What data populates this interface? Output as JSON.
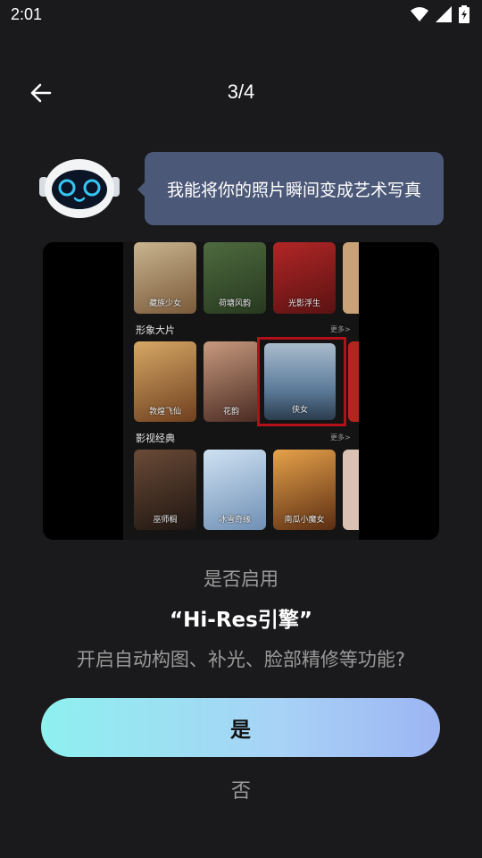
{
  "status": {
    "time": "2:01"
  },
  "header": {
    "page_indicator": "3/4"
  },
  "bubble": {
    "text": "我能将你的照片瞬间变成艺术写真"
  },
  "preview": {
    "row1_labels": [
      "藏族少女",
      "荷塘风韵",
      "光影浮生"
    ],
    "section2": {
      "title": "形象大片",
      "more": "更多>"
    },
    "row2_labels": [
      "敦煌飞仙",
      "花韵",
      "侠女"
    ],
    "section3": {
      "title": "影视经典",
      "more": "更多>"
    },
    "row3_labels": [
      "巫师榈",
      "冰雪奇缘",
      "南瓜小魔女"
    ]
  },
  "prompt": {
    "line1": "是否启用",
    "line2": "“Hi-Res引擎”",
    "line3": "开启自动构图、补光、脸部精修等功能?"
  },
  "buttons": {
    "yes": "是",
    "no": "否"
  },
  "colors": {
    "accent_start": "#8ef0ef",
    "accent_end": "#9cb5f3",
    "bubble": "#4b5877",
    "highlight": "#b4101a"
  }
}
